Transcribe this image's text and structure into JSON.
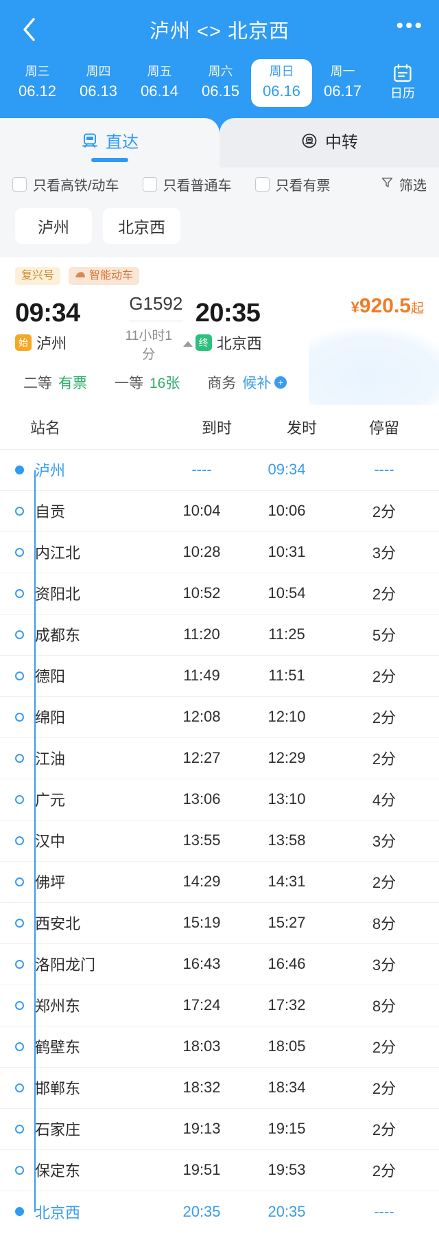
{
  "header": {
    "title": "泸州 <> 北京西",
    "back_icon": "chevron-left-icon",
    "more_icon": "ellipsis-icon",
    "dates": [
      {
        "dow": "周三",
        "date": "06.12",
        "active": false
      },
      {
        "dow": "周四",
        "date": "06.13",
        "active": false
      },
      {
        "dow": "周五",
        "date": "06.14",
        "active": false
      },
      {
        "dow": "周六",
        "date": "06.15",
        "active": false
      },
      {
        "dow": "周日",
        "date": "06.16",
        "active": true
      },
      {
        "dow": "周一",
        "date": "06.17",
        "active": false
      }
    ],
    "calendar": {
      "label": "日历",
      "icon": "calendar-icon"
    },
    "bg_color": "#2e9bf5"
  },
  "tabs": [
    {
      "label": "直达",
      "icon": "train-front-icon",
      "active": true
    },
    {
      "label": "中转",
      "icon": "transfer-train-icon",
      "active": false
    }
  ],
  "filters": {
    "checkboxes": [
      {
        "label": "只看高铁/动车",
        "checked": false
      },
      {
        "label": "只看普通车",
        "checked": false
      },
      {
        "label": "只看有票",
        "checked": false
      }
    ],
    "sort": {
      "label": "筛选",
      "icon": "funnel-icon"
    }
  },
  "station_chips": [
    {
      "label": "泸州"
    },
    {
      "label": "北京西"
    }
  ],
  "train": {
    "tags": [
      {
        "label": "复兴号",
        "style": "fuxing"
      },
      {
        "label": "智能动车",
        "style": "smart",
        "icon": "smart-train-icon"
      }
    ],
    "depart_time": "09:34",
    "arrive_time": "20:35",
    "train_no": "G1592",
    "duration": "11小时1分",
    "depart_station": "泸州",
    "arrive_station": "北京西",
    "start_badge": "始",
    "end_badge": "终",
    "price_currency": "¥",
    "price_value": "920.5",
    "price_suffix": "起",
    "price_color": "#f07c27",
    "seats": [
      {
        "name": "二等",
        "value": "有票",
        "kind": "green"
      },
      {
        "name": "一等",
        "value": "16张",
        "kind": "green"
      },
      {
        "name": "商务",
        "value": "候补",
        "kind": "blue",
        "plus": "+"
      }
    ]
  },
  "timetable": {
    "columns": {
      "station": "站名",
      "arrive": "到时",
      "depart": "发时",
      "stay": "停留"
    },
    "rows": [
      {
        "station": "泸州",
        "arrive": "----",
        "depart": "09:34",
        "stay": "----",
        "endpoint": true
      },
      {
        "station": "自贡",
        "arrive": "10:04",
        "depart": "10:06",
        "stay": "2分",
        "endpoint": false
      },
      {
        "station": "内江北",
        "arrive": "10:28",
        "depart": "10:31",
        "stay": "3分",
        "endpoint": false
      },
      {
        "station": "资阳北",
        "arrive": "10:52",
        "depart": "10:54",
        "stay": "2分",
        "endpoint": false
      },
      {
        "station": "成都东",
        "arrive": "11:20",
        "depart": "11:25",
        "stay": "5分",
        "endpoint": false
      },
      {
        "station": "德阳",
        "arrive": "11:49",
        "depart": "11:51",
        "stay": "2分",
        "endpoint": false
      },
      {
        "station": "绵阳",
        "arrive": "12:08",
        "depart": "12:10",
        "stay": "2分",
        "endpoint": false
      },
      {
        "station": "江油",
        "arrive": "12:27",
        "depart": "12:29",
        "stay": "2分",
        "endpoint": false
      },
      {
        "station": "广元",
        "arrive": "13:06",
        "depart": "13:10",
        "stay": "4分",
        "endpoint": false
      },
      {
        "station": "汉中",
        "arrive": "13:55",
        "depart": "13:58",
        "stay": "3分",
        "endpoint": false
      },
      {
        "station": "佛坪",
        "arrive": "14:29",
        "depart": "14:31",
        "stay": "2分",
        "endpoint": false
      },
      {
        "station": "西安北",
        "arrive": "15:19",
        "depart": "15:27",
        "stay": "8分",
        "endpoint": false
      },
      {
        "station": "洛阳龙门",
        "arrive": "16:43",
        "depart": "16:46",
        "stay": "3分",
        "endpoint": false
      },
      {
        "station": "郑州东",
        "arrive": "17:24",
        "depart": "17:32",
        "stay": "8分",
        "endpoint": false
      },
      {
        "station": "鹤壁东",
        "arrive": "18:03",
        "depart": "18:05",
        "stay": "2分",
        "endpoint": false
      },
      {
        "station": "邯郸东",
        "arrive": "18:32",
        "depart": "18:34",
        "stay": "2分",
        "endpoint": false
      },
      {
        "station": "石家庄",
        "arrive": "19:13",
        "depart": "19:15",
        "stay": "2分",
        "endpoint": false
      },
      {
        "station": "保定东",
        "arrive": "19:51",
        "depart": "19:53",
        "stay": "2分",
        "endpoint": false
      },
      {
        "station": "北京西",
        "arrive": "20:35",
        "depart": "20:35",
        "stay": "----",
        "endpoint": true
      }
    ]
  }
}
